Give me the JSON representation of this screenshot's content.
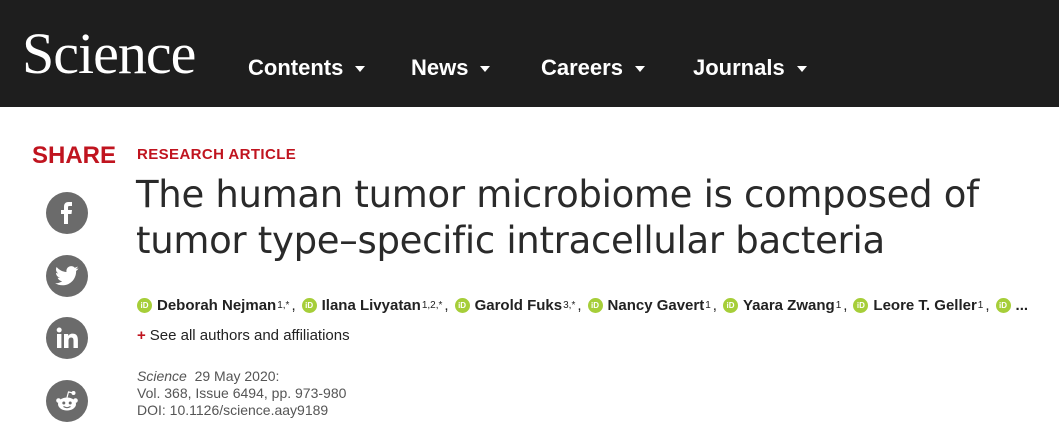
{
  "header": {
    "logo": "Science",
    "nav": [
      {
        "label": "Contents"
      },
      {
        "label": "News"
      },
      {
        "label": "Careers"
      },
      {
        "label": "Journals"
      }
    ]
  },
  "share": {
    "title": "SHARE",
    "buttons": [
      {
        "icon": "facebook-icon"
      },
      {
        "icon": "twitter-icon"
      },
      {
        "icon": "linkedin-icon"
      },
      {
        "icon": "reddit-icon"
      }
    ]
  },
  "article": {
    "type_label": "RESEARCH ARTICLE",
    "title": "The human tumor microbiome is composed of tumor type–specific intracellular bacteria",
    "authors": [
      {
        "name": "Deborah Nejman",
        "aff": "1,*"
      },
      {
        "name": "Ilana Livyatan",
        "aff": "1,2,*"
      },
      {
        "name": "Garold Fuks",
        "aff": "3,*"
      },
      {
        "name": "Nancy Gavert",
        "aff": "1"
      },
      {
        "name": "Yaara Zwang",
        "aff": "1"
      },
      {
        "name": "Leore T. Geller",
        "aff": "1"
      }
    ],
    "orcid_label": "iD",
    "authors_more": "...",
    "see_all": "See all authors and affiliations",
    "journal": "Science",
    "date": "29 May 2020:",
    "volume_line": "Vol. 368, Issue 6494, pp. 973-980",
    "doi_line": "DOI: 10.1126/science.aay9189"
  },
  "colors": {
    "header_bg": "#1e1e1e",
    "accent_red": "#c0141f",
    "orcid_green": "#a6ce39",
    "share_gray": "#6b6b6b"
  }
}
